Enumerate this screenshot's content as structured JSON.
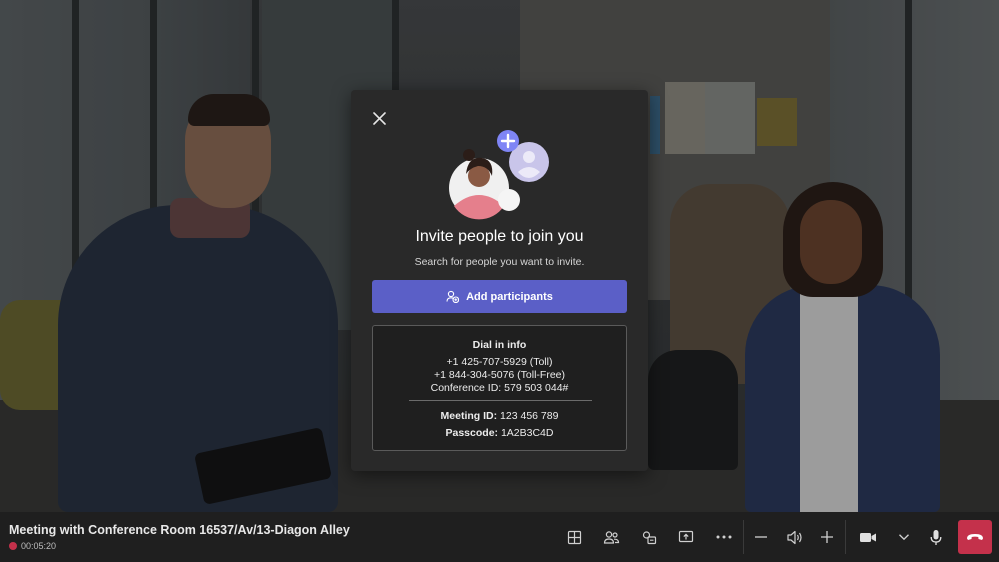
{
  "dialog": {
    "title": "Invite people to join you",
    "subtitle": "Search for people you want to invite.",
    "add_button_label": "Add participants",
    "dial_in": {
      "heading": "Dial in info",
      "toll": "+1 425-707-5929 (Toll)",
      "toll_free": "+1 844-304-5076 (Toll-Free)",
      "conference_id": "Conference ID: 579 503 044#",
      "meeting_id_label": "Meeting ID:",
      "meeting_id_value": "123 456 789",
      "passcode_label": "Passcode:",
      "passcode_value": "1A2B3C4D"
    }
  },
  "meeting": {
    "title": "Meeting with Conference Room 16537/Av/13-Diagon Alley",
    "elapsed": "00:05:20"
  },
  "toolbar": {
    "icons": [
      "layout-icon",
      "people-icon",
      "share-tray-icon",
      "share-screen-icon",
      "more-icon",
      "volume-down-icon",
      "speaker-icon",
      "volume-up-icon",
      "camera-icon",
      "chevron-down-icon",
      "microphone-icon",
      "hang-up-icon"
    ]
  },
  "colors": {
    "accent": "#5b5fc7",
    "hangup": "#c4314b",
    "dialog_bg": "#292929",
    "bar_bg": "#1f1f1f"
  }
}
